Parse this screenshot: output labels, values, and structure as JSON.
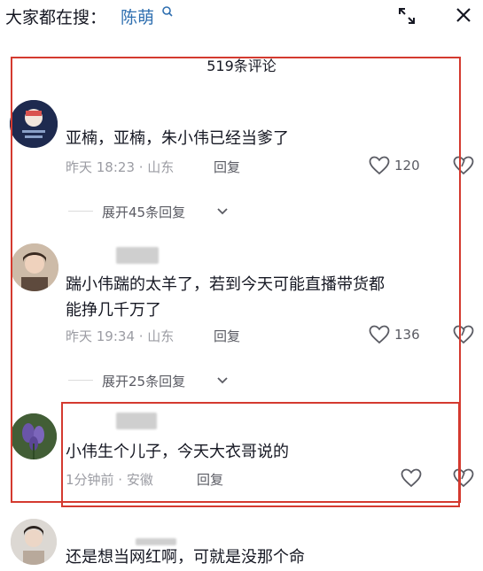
{
  "header": {
    "search_prefix": "大家都在搜：",
    "search_term": "陈萌",
    "expand_icon": "fullscreen-icon",
    "close_icon": "close-icon"
  },
  "comment_count": "519条评论",
  "colors": {
    "annotation": "#d43a2f",
    "link": "#2f6fb0",
    "meta": "#9b9ca3"
  },
  "comments": [
    {
      "text": "亚楠，亚楠，朱小伟已经当爹了",
      "time": "昨天 18:23 · 山东",
      "reply": "回复",
      "likes": "120",
      "expand": "展开45条回复"
    },
    {
      "text_line1": "踹小伟踹的太羊了，若到今天可能直播带货都",
      "text_line2": "能挣几千万了",
      "time": "昨天 19:34 · 山东",
      "reply": "回复",
      "likes": "136",
      "expand": "展开25条回复"
    },
    {
      "text": "小伟生个儿子，今天大衣哥说的",
      "time": "1分钟前 · 安徽",
      "reply": "回复"
    },
    {
      "text": "还是想当网红啊，可就是没那个命"
    }
  ]
}
